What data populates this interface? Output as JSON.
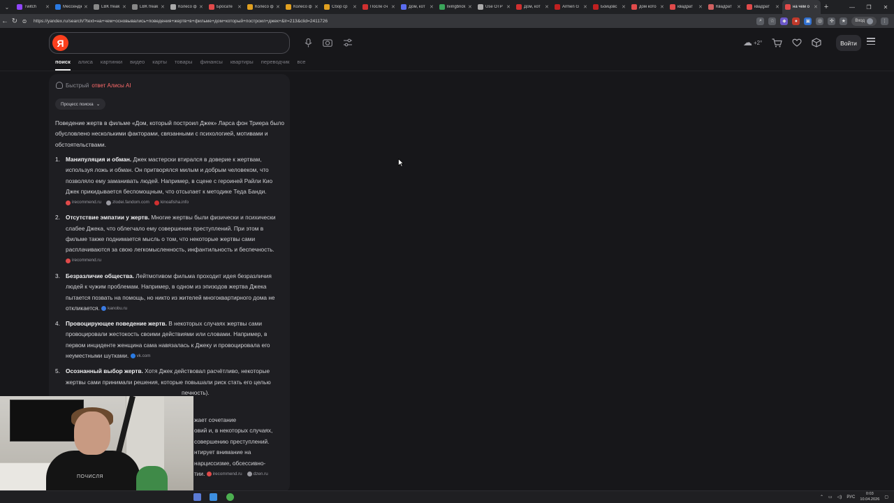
{
  "browser": {
    "tabs": [
      {
        "title": "Twitch",
        "color": "#9146ff"
      },
      {
        "title": "Мессенджер",
        "color": "#2a7ae2"
      },
      {
        "title": "LBK freak",
        "color": "#888888"
      },
      {
        "title": "LBK freak",
        "color": "#888888"
      },
      {
        "title": "Колесо ф",
        "color": "#aaaaaa"
      },
      {
        "title": "Бросате",
        "color": "#e04a4a"
      },
      {
        "title": "Колесо ф",
        "color": "#e0a020"
      },
      {
        "title": "Колесо ф",
        "color": "#e0a020"
      },
      {
        "title": "Сбор ср",
        "color": "#e0a020"
      },
      {
        "title": "После сч",
        "color": "#d03030"
      },
      {
        "title": "Дом, кот",
        "color": "#5a6cf0"
      },
      {
        "title": "livingbrick",
        "color": "#3aa55a"
      },
      {
        "title": "Use OTP",
        "color": "#aaaaaa"
      },
      {
        "title": "Дом, кот",
        "color": "#d03030"
      },
      {
        "title": "Armen G",
        "color": "#c02020"
      },
      {
        "title": "Бойцовс",
        "color": "#c02020"
      },
      {
        "title": "дом кото",
        "color": "#e04a4a"
      },
      {
        "title": "квадрат",
        "color": "#e04a4a"
      },
      {
        "title": "Квадрат",
        "color": "#d06060"
      },
      {
        "title": "квадрат",
        "color": "#e04a4a"
      },
      {
        "title": "на чем о",
        "color": "#e04a4a",
        "active": true
      }
    ],
    "url": "https://yandex.ru/search/?text=на+чем+основывались+поведения+жертв+в+фильме+дом+который+построил+джек+&lr=213&clid=2411726",
    "login_chip": "Вход"
  },
  "yandex": {
    "logo": "Я",
    "search_value": "",
    "weather": "+2°",
    "login_button": "Войти",
    "services": [
      "поиск",
      "алиса",
      "картинки",
      "видео",
      "карты",
      "товары",
      "финансы",
      "квартиры",
      "переводчик",
      "все"
    ]
  },
  "answer": {
    "header_prefix": "Быстрый ",
    "header_accent": "ответ Алисы AI",
    "process_chip": "Процесс поиска",
    "intro": "Поведение жертв в фильме «Дом, который построил Джек» Ларса фон Триера было обусловлено несколькими факторами, связанными с психологией, мотивами и обстоятельствами.",
    "items": [
      {
        "num": "1.",
        "title": "Манипуляция и обман.",
        "text": " Джек мастерски втирался в доверие к жертвам, используя ложь и обман. Он притворялся милым и добрым человеком, что позволяло ему заманивать людей. Например, в сцене с героиней Райли Кио Джек прикидывается беспомощным, что отсылает к методике Теда Банди.",
        "sources": [
          {
            "name": "irecommend.ru",
            "color": "#e04a4a"
          },
          {
            "name": "zlodei.fandom.com",
            "color": "#9a9aa1"
          },
          {
            "name": "kinoafisha.info",
            "color": "#d03030"
          }
        ]
      },
      {
        "num": "2.",
        "title": "Отсутствие эмпатии у жертв.",
        "text": " Многие жертвы были физически и психически слабее Джека, что облегчало ему совершение преступлений. При этом в фильме также поднимается мысль о том, что некоторые жертвы сами расплачиваются за свою легкомысленность, инфантильность и беспечность.",
        "sources": [
          {
            "name": "irecommend.ru",
            "color": "#e04a4a"
          }
        ]
      },
      {
        "num": "3.",
        "title": "Безразличие общества.",
        "text": " Лейтмотивом фильма проходит идея безразличия людей к чужим проблемам. Например, в одном из эпизодов жертва Джека пытается позвать на помощь, но никто из жителей многоквартирного дома не откликается.",
        "sources": [
          {
            "name": "kanobu.ru",
            "color": "#3a7ae0"
          }
        ]
      },
      {
        "num": "4.",
        "title": "Провоцирующее поведение жертв.",
        "text": " В некоторых случаях жертвы сами провоцировали жестокость своими действиями или словами. Например, в первом инциденте женщина сама навязалась к Джеку и провоцировала его неуместными шутками.",
        "sources": [
          {
            "name": "vk.com",
            "color": "#2a7ae2"
          }
        ]
      },
      {
        "num": "5.",
        "title": "Осознанный выбор жертв.",
        "text": " Хотя Джек действовал расчётливо, некоторые жертвы сами принимали решения, которые повышали риск стать его целью",
        "tail": "печность).",
        "sources": []
      }
    ],
    "fragments": [
      "жает сочетание",
      "овий и, в некоторых случаях,",
      "совершению преступлений.",
      "нтирует внимание на",
      "нарциссизме, обсессивно-",
      "тии."
    ],
    "fragment_sources": [
      {
        "name": "irecommend.ru",
        "color": "#e04a4a"
      },
      {
        "name": "dzen.ru",
        "color": "#9a9aa1"
      }
    ]
  },
  "webcam": {
    "shirt_text": "ПОЧИСЛЯ"
  },
  "taskbar": {
    "lang": "РУС",
    "time": "0:03",
    "date": "10.04.2026"
  }
}
